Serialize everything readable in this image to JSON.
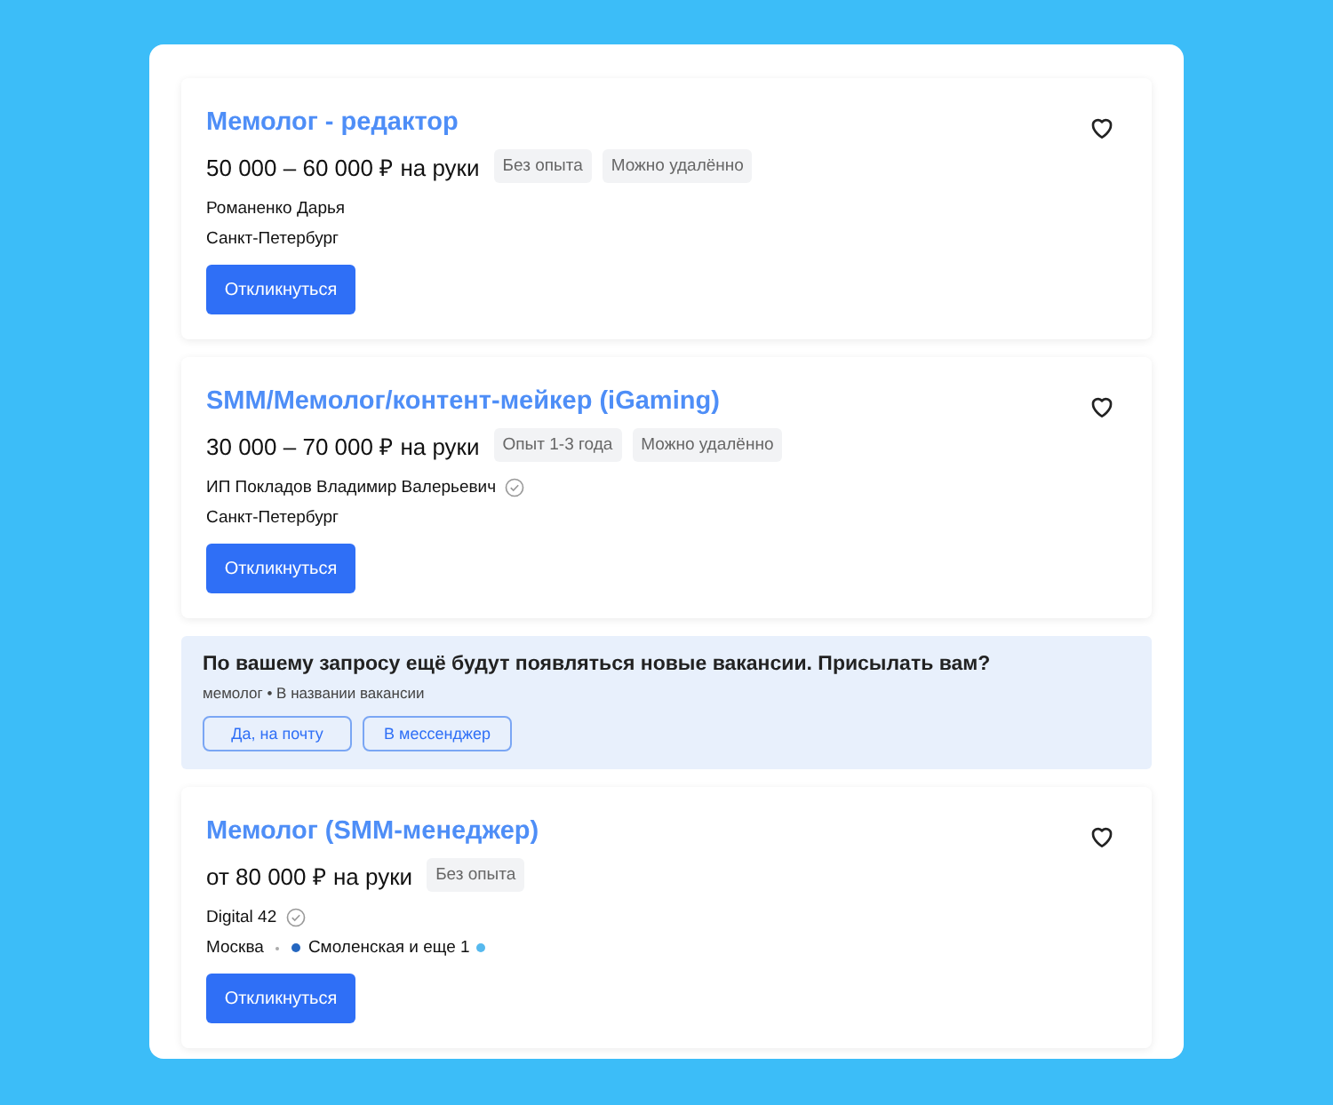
{
  "items": [
    {
      "kind": "vacancy",
      "title": "Мемолог - редактор",
      "salary": "50 000 – 60 000 ₽ на руки",
      "tags": [
        "Без опыта",
        "Можно удалённо"
      ],
      "employer": "Романенко Дарья",
      "verified": false,
      "city": "Санкт-Петербург",
      "button": "Откликнуться"
    },
    {
      "kind": "vacancy",
      "title": "SMM/Мемолог/контент-мейкер (iGaming)",
      "salary": "30 000 – 70 000 ₽ на руки",
      "tags": [
        "Опыт 1-3 года",
        "Можно удалённо"
      ],
      "employer": "ИП Покладов Владимир Валерьевич",
      "verified": true,
      "city": "Санкт-Петербург",
      "button": "Откликнуться"
    },
    {
      "kind": "banner",
      "title": "По вашему запросу ещё будут появляться новые вакансии. Присылать вам?",
      "subtitle": "мемолог • В названии вакансии",
      "buttons": [
        "Да, на почту",
        "В мессенджер"
      ]
    },
    {
      "kind": "vacancy",
      "title": "Мемолог (SMM-менеджер)",
      "salary": "от 80 000 ₽ на руки",
      "tags": [
        "Без опыта"
      ],
      "employer": "Digital 42",
      "verified": true,
      "city": "Москва",
      "metro": {
        "name": "Смоленская и еще 1",
        "color": "#2567c0"
      },
      "more_lines": [
        {
          "color": "#56b9ee"
        }
      ],
      "button": "Откликнуться"
    }
  ]
}
